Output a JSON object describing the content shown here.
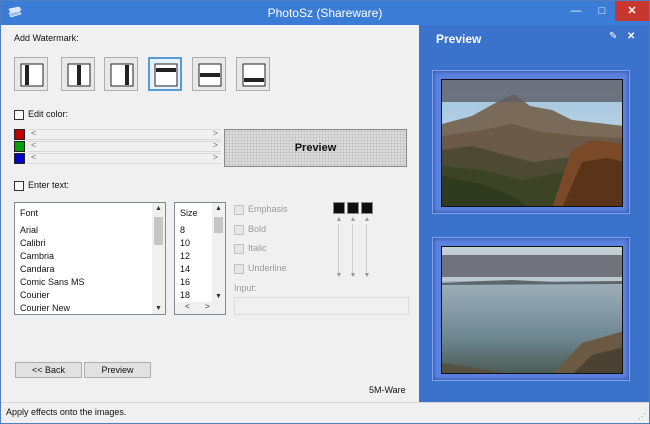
{
  "window": {
    "title": "PhotoSz (Shareware)",
    "controls": {
      "minimize": "—",
      "maximize": "□",
      "close": "✕"
    }
  },
  "watermark": {
    "label": "Add Watermark:",
    "options": [
      {
        "icon": "watermark-left-bar-icon",
        "selected": false
      },
      {
        "icon": "watermark-center-vertical-bar-icon",
        "selected": false
      },
      {
        "icon": "watermark-right-bar-icon",
        "selected": false
      },
      {
        "icon": "watermark-top-bar-icon",
        "selected": true
      },
      {
        "icon": "watermark-middle-horizontal-bar-icon",
        "selected": false
      },
      {
        "icon": "watermark-bottom-bar-icon",
        "selected": false
      }
    ]
  },
  "edit_color": {
    "label": "Edit color:",
    "checked": false,
    "channels": [
      {
        "name": "red",
        "color": "#c00000"
      },
      {
        "name": "green",
        "color": "#00a000"
      },
      {
        "name": "blue",
        "color": "#0000c8"
      }
    ],
    "arrow_left": "<",
    "arrow_right": ">"
  },
  "preview_button": {
    "label": "Preview"
  },
  "enter_text": {
    "label": "Enter text:",
    "checked": false
  },
  "font_list": {
    "header": "Font",
    "items": [
      "Arial",
      "Calibri",
      "Cambria",
      "Candara",
      "Comic Sans MS",
      "Courier",
      "Courier New"
    ]
  },
  "size_list": {
    "header": "Size",
    "items": [
      "8",
      "10",
      "12",
      "14",
      "16",
      "18"
    ]
  },
  "scroll_glyphs": {
    "up": "▲",
    "down": "▼",
    "left": "<",
    "right": ">"
  },
  "text_styles": [
    {
      "label": "Emphasis",
      "checked": false,
      "enabled": false
    },
    {
      "label": "Bold",
      "checked": false,
      "enabled": false
    },
    {
      "label": "Italic",
      "checked": false,
      "enabled": false
    },
    {
      "label": "Underline",
      "checked": false,
      "enabled": false
    }
  ],
  "text_color_swatches": [
    "#0d0d0d",
    "#0d0d0d",
    "#0d0d0d"
  ],
  "input": {
    "label": "Input:",
    "value": ""
  },
  "nav": {
    "back_label": "<< Back",
    "preview_label": "Preview"
  },
  "credit": "5M-Ware",
  "preview_panel": {
    "title": "Preview",
    "pin_icon": "✎",
    "close_icon": "✕",
    "images": [
      "mountain-valley-image",
      "lake-shore-image"
    ]
  },
  "status": {
    "text": "Apply effects onto the images.",
    "grip": "⋰"
  }
}
